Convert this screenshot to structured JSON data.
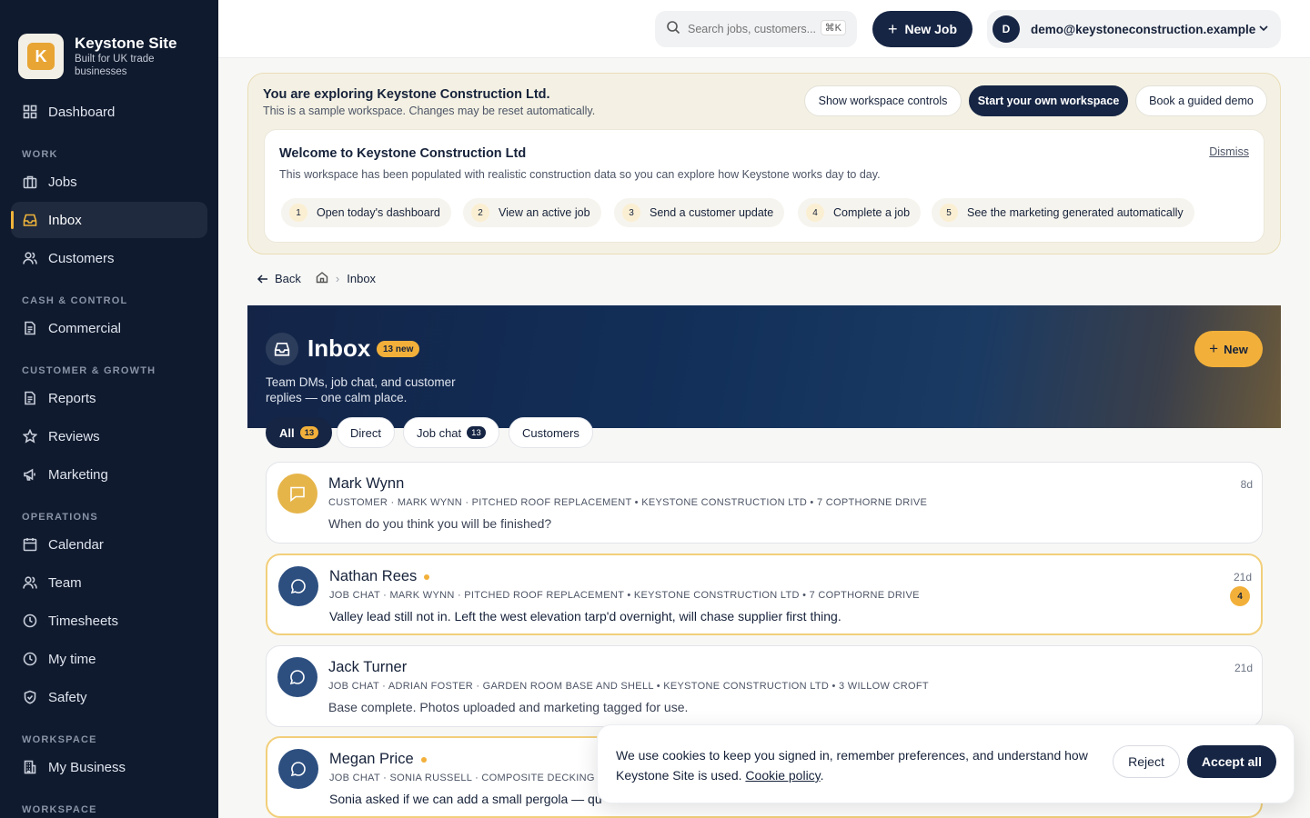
{
  "brand": {
    "name": "Keystone Site",
    "tagline": "Built for UK trade businesses",
    "logo_letter": "K",
    "accent": "#e8a534"
  },
  "sidebar": {
    "dashboard": "Dashboard",
    "sections": [
      {
        "label": "WORK",
        "items": [
          "Jobs",
          "Inbox",
          "Customers"
        ]
      },
      {
        "label": "CASH & CONTROL",
        "items": [
          "Commercial"
        ]
      },
      {
        "label": "CUSTOMER & GROWTH",
        "items": [
          "Reports",
          "Reviews",
          "Marketing"
        ]
      },
      {
        "label": "OPERATIONS",
        "items": [
          "Calendar",
          "Team",
          "Timesheets",
          "My time",
          "Safety"
        ]
      },
      {
        "label": "WORKSPACE",
        "items": [
          "My Business"
        ]
      },
      {
        "label": "WORKSPACE",
        "items": []
      }
    ],
    "active": "Inbox"
  },
  "topbar": {
    "search_placeholder": "Search jobs, customers...",
    "search_shortcut": "⌘K",
    "new_job_label": "New Job",
    "user_initial": "D",
    "user_email": "demo@keystoneconstruction.example"
  },
  "explore": {
    "title": "You are exploring Keystone Construction Ltd.",
    "subtitle": "This is a sample workspace. Changes may be reset automatically.",
    "buttons": [
      "Show workspace controls",
      "Start your own workspace",
      "Book a guided demo"
    ]
  },
  "welcome": {
    "title": "Welcome to Keystone Construction Ltd",
    "subtitle": "This workspace has been populated with realistic construction data so you can explore how Keystone works day to day.",
    "dismiss": "Dismiss",
    "steps": [
      {
        "num": "1",
        "label": "Open today's dashboard"
      },
      {
        "num": "2",
        "label": "View an active job"
      },
      {
        "num": "3",
        "label": "Send a customer update"
      },
      {
        "num": "4",
        "label": "Complete a job"
      },
      {
        "num": "5",
        "label": "See the marketing generated automatically"
      }
    ]
  },
  "breadcrumb": {
    "back": "Back",
    "current": "Inbox"
  },
  "hero": {
    "title": "Inbox",
    "badge": "13 new",
    "subtitle": "Team DMs, job chat, and customer replies — one calm place.",
    "new_label": "New"
  },
  "tabs": [
    {
      "label": "All",
      "count": "13"
    },
    {
      "label": "Direct",
      "count": ""
    },
    {
      "label": "Job chat",
      "count": "13"
    },
    {
      "label": "Customers",
      "count": ""
    }
  ],
  "messages": [
    {
      "name": "Mark Wynn",
      "meta": "Customer · Mark Wynn · Pitched Roof Replacement • Keystone Construction Ltd • 7 Copthorne Drive",
      "text": "When do you think you will be finished?",
      "time": "8d",
      "unread_count": ""
    },
    {
      "name": "Nathan Rees",
      "meta": "Job chat · Mark Wynn · Pitched Roof Replacement • Keystone Construction Ltd • 7 Copthorne Drive",
      "text": "Valley lead still not in. Left the west elevation tarp'd overnight, will chase supplier first thing.",
      "time": "21d",
      "unread_count": "4"
    },
    {
      "name": "Jack Turner",
      "meta": "Job chat · Adrian Foster · Garden Room Base and Shell • Keystone Construction Ltd • 3 Willow Croft",
      "text": "Base complete. Photos uploaded and marketing tagged for use.",
      "time": "21d",
      "unread_count": ""
    },
    {
      "name": "Megan Price",
      "meta": "Job chat · Sonia Russell · Composite Decking an",
      "text": "Sonia asked if we can add a small pergola — qu",
      "time": "",
      "unread_count": ""
    }
  ],
  "cookie": {
    "text": "We use cookies to keep you signed in, remember preferences, and understand how Keystone Site is used.",
    "link": "Cookie policy",
    "reject": "Reject",
    "accept": "Accept all"
  }
}
